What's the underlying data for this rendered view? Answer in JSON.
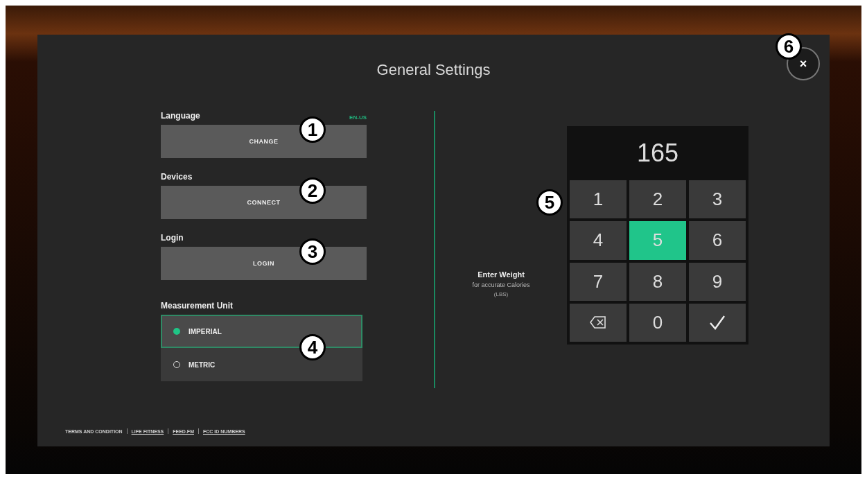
{
  "dialog": {
    "title": "General Settings",
    "close": {
      "symbol": "×",
      "callout": "6"
    }
  },
  "settings": [
    {
      "kind": "button",
      "label": "Language",
      "value": "EN-US",
      "button": "CHANGE",
      "callout": "1"
    },
    {
      "kind": "button",
      "label": "Devices",
      "button": "CONNECT",
      "callout": "2"
    },
    {
      "kind": "button",
      "label": "Login",
      "button": "LOGIN",
      "callout": "3"
    },
    {
      "kind": "radio",
      "label": "Measurement Unit",
      "callout": "4",
      "options": [
        {
          "label": "IMPERIAL",
          "selected": true
        },
        {
          "label": "METRIC",
          "selected": false
        }
      ]
    }
  ],
  "weight": {
    "title": "Enter Weight",
    "subtitle": "for accurate Calories",
    "unit": "(LBS)",
    "display": "165",
    "callout": "5",
    "keys": [
      {
        "kind": "digit",
        "label": "1",
        "selected": false
      },
      {
        "kind": "digit",
        "label": "2",
        "selected": false
      },
      {
        "kind": "digit",
        "label": "3",
        "selected": false
      },
      {
        "kind": "digit",
        "label": "4",
        "selected": false
      },
      {
        "kind": "digit",
        "label": "5",
        "selected": true
      },
      {
        "kind": "digit",
        "label": "6",
        "selected": false
      },
      {
        "kind": "digit",
        "label": "7",
        "selected": false
      },
      {
        "kind": "digit",
        "label": "8",
        "selected": false
      },
      {
        "kind": "digit",
        "label": "9",
        "selected": false
      },
      {
        "kind": "backspace",
        "selected": false
      },
      {
        "kind": "digit",
        "label": "0",
        "selected": false
      },
      {
        "kind": "confirm",
        "selected": false
      }
    ]
  },
  "footer": {
    "label": "TERMS AND CONDITION",
    "links": [
      "LIFE FITNESS",
      "FEED.FM",
      "FCC ID NUMBERS"
    ]
  }
}
